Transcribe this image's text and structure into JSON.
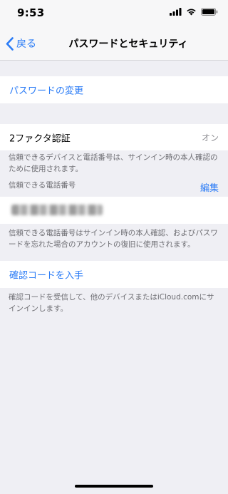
{
  "status_bar": {
    "time": "9:53"
  },
  "nav": {
    "back_label": "戻る",
    "title": "パスワードとセキュリティ"
  },
  "password_change": {
    "label": "パスワードの変更"
  },
  "two_factor": {
    "label": "2ファクタ認証",
    "value": "オン",
    "footnote": "信頼できるデバイスと電話番号は、サインイン時の本人確認のために使用されます。"
  },
  "trusted_numbers": {
    "header": "信頼できる電話番号",
    "edit_label": "編集",
    "footnote": "信頼できる電話番号はサインイン時の本人確認、およびパスワードを忘れた場合のアカウントの復旧に使用されます。"
  },
  "verification_code": {
    "label": "確認コードを入手",
    "footnote": "確認コードを受信して、他のデバイスまたはiCloud.comにサインインします。"
  },
  "colors": {
    "accent": "#2b7cf6",
    "background": "#efeff4",
    "secondary_text": "#6d6d72"
  }
}
